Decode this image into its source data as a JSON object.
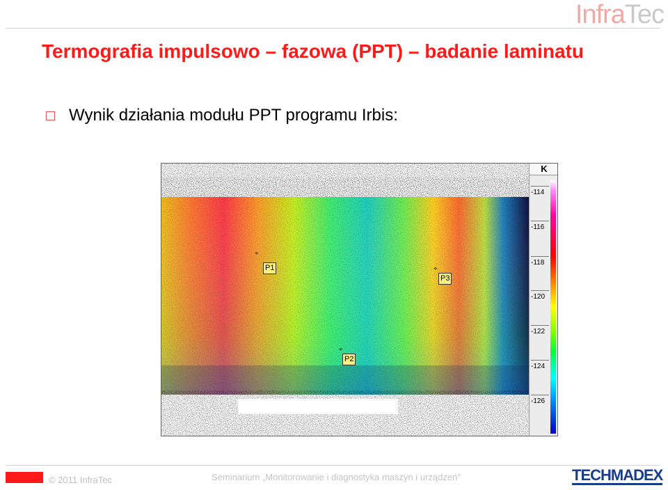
{
  "header": {
    "logo_part1": "Infra",
    "logo_part2": "Tec",
    "title": "Termografia impulsowo – fazowa (PPT) – badanie laminatu"
  },
  "content": {
    "bullet_text": "Wynik działania modułu PPT programu Irbis:",
    "thermogram": {
      "unit": "K",
      "scale_ticks": [
        "-114",
        "-116",
        "-118",
        "-120",
        "-122",
        "-124",
        "-126"
      ],
      "markers": [
        "P1",
        "P2",
        "P3"
      ]
    }
  },
  "footer": {
    "copyright": "© 2011 InfraTec",
    "seminar": "Seminarium „Monitorowanie i diagnostyka maszyn i urządzeń”",
    "partner": "TECHMADEX"
  },
  "colors": {
    "title": "#ff1a1a",
    "brand_blue": "#183d8c"
  }
}
